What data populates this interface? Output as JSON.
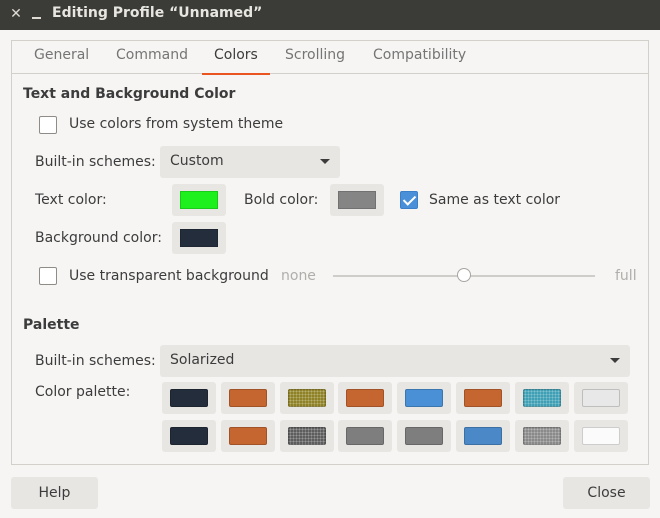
{
  "window": {
    "title": "Editing Profile “Unnamed”"
  },
  "tabs": [
    "General",
    "Command",
    "Colors",
    "Scrolling",
    "Compatibility"
  ],
  "active_tab": "Colors",
  "text_bg": {
    "section_title": "Text and Background Color",
    "use_system_label": "Use colors from system theme",
    "use_system_checked": false,
    "schemes_label": "Built-in schemes:",
    "schemes_value": "Custom",
    "text_color_label": "Text color:",
    "text_color": "#1ef01e",
    "bold_color_label": "Bold color:",
    "bold_color": "#858585",
    "same_as_text_label": "Same as text color",
    "same_as_text_checked": true,
    "bg_color_label": "Background color:",
    "bg_color": "#232d3b",
    "transparent_label": "Use transparent background",
    "transparent_checked": false,
    "slider_min": "none",
    "slider_max": "full",
    "slider_value": 0.5
  },
  "palette": {
    "section_title": "Palette",
    "schemes_label": "Built-in schemes:",
    "schemes_value": "Solarized",
    "palette_label": "Color palette:",
    "row1": [
      "#232d3b",
      "#c5652f",
      "#8f8226",
      "#c5652f",
      "#4a90d6",
      "#c5652f",
      "#3e9fb5",
      "#e8e8e8"
    ],
    "row2": [
      "#232d3b",
      "#c5652f",
      "#5d5d5d",
      "#7e7e7e",
      "#7e7e7e",
      "#4a88c8",
      "#8a8a8a",
      "#fbfbfb"
    ]
  },
  "buttons": {
    "help": "Help",
    "close": "Close"
  }
}
